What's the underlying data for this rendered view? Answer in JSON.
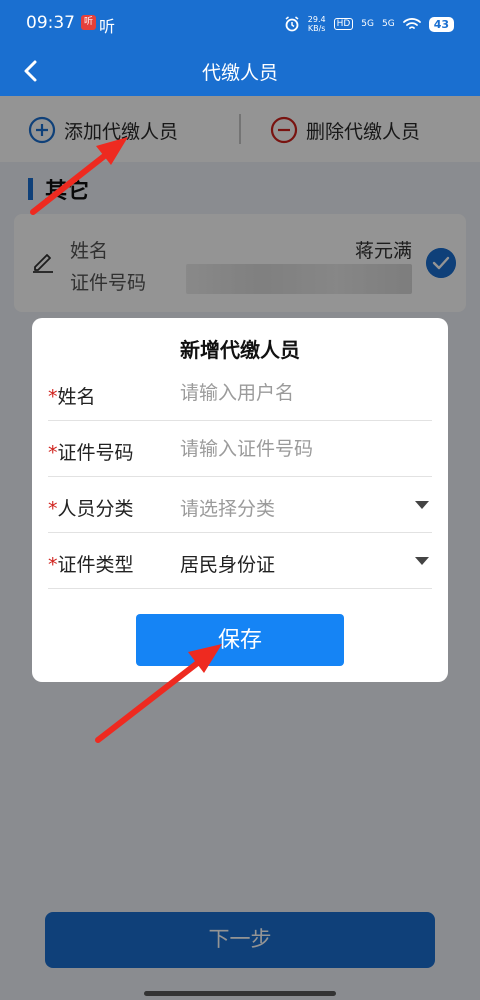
{
  "status_bar": {
    "time": "09:37",
    "app_badge": "听",
    "app_text": "听",
    "net_speed": "29.4",
    "net_unit": "KB/s",
    "hd_label": "HD",
    "sig1": "5G",
    "sig2": "5G",
    "battery": "43"
  },
  "nav": {
    "title": "代缴人员"
  },
  "actions": {
    "add_label": "添加代缴人员",
    "delete_label": "删除代缴人员"
  },
  "section": {
    "title": "其它"
  },
  "person_card": {
    "name_label": "姓名",
    "name_value": "蒋元满",
    "id_label": "证件号码"
  },
  "dialog": {
    "title": "新增代缴人员",
    "required_mark": "*",
    "fields": [
      {
        "label": "姓名",
        "placeholder": "请输入用户名"
      },
      {
        "label": "证件号码",
        "placeholder": "请输入证件号码"
      },
      {
        "label": "人员分类",
        "placeholder": "请选择分类"
      },
      {
        "label": "证件类型",
        "value": "居民身份证"
      }
    ],
    "save_label": "保存"
  },
  "footer": {
    "next_label": "下一步"
  },
  "colors": {
    "primary": "#1a6fd0",
    "save_button": "#1584f5",
    "required": "#d0211c",
    "annotation_arrow": "#ee2a20"
  }
}
